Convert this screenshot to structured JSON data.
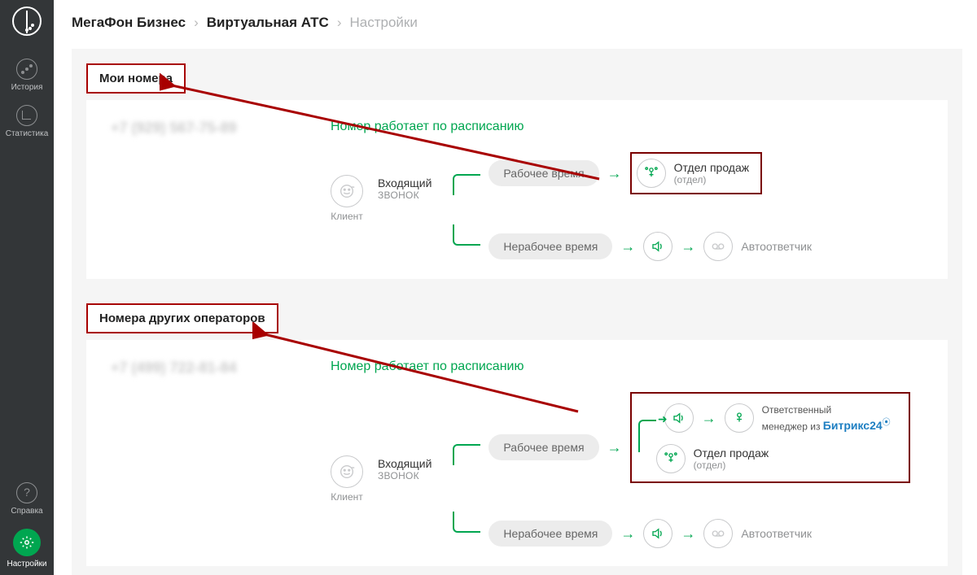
{
  "sidebar": {
    "history": "История",
    "stats": "Статистика",
    "help": "Справка",
    "settings": "Настройки"
  },
  "breadcrumbs": {
    "a": "МегаФон Бизнес",
    "b": "Виртуальная АТС",
    "c": "Настройки"
  },
  "sections": {
    "my_numbers": "Мои номера",
    "other_ops": "Номера других операторов"
  },
  "panel1": {
    "phone": "+7 (929) 567-75-89",
    "schedule_title": "Номер работает по расписанию",
    "client": "Клиент",
    "incoming": "Входящий",
    "call": "звонок",
    "work": "Рабочее время",
    "nonwork": "Нерабочее время",
    "sales": "Отдел продаж",
    "dept": "(отдел)",
    "voicemail": "Автоответчик"
  },
  "panel2": {
    "phone": "+7 (499) 722-81-84",
    "schedule_title": "Номер работает по расписанию",
    "client": "Клиент",
    "incoming": "Входящий",
    "call": "звонок",
    "work": "Рабочее время",
    "nonwork": "Нерабочее время",
    "resp_mgr": "Ответственный",
    "resp_from": "менеджер из",
    "bitrix": "Битрикс",
    "bitrix_num": "24",
    "sales": "Отдел продаж",
    "dept": "(отдел)",
    "voicemail": "Автоответчик"
  }
}
